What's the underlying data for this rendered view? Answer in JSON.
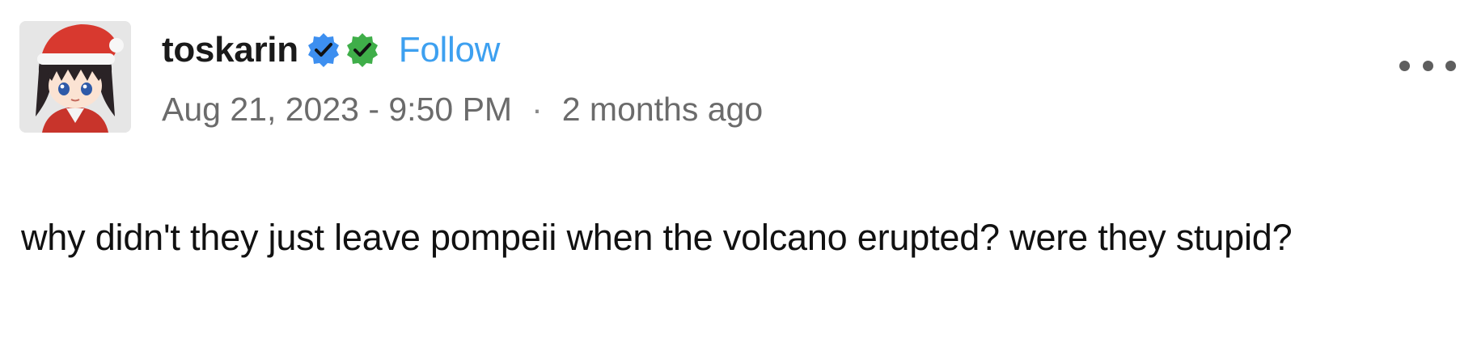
{
  "post": {
    "author": {
      "username": "toskarin",
      "follow_label": "Follow"
    },
    "badges": [
      {
        "icon": "verified-check-icon",
        "color": "#3d8ff0"
      },
      {
        "icon": "verified-check-icon",
        "color": "#3fae49"
      }
    ],
    "meta": {
      "timestamp": "Aug 21, 2023 - 9:50 PM",
      "separator": "·",
      "relative_time": "2 months ago"
    },
    "more_icon": "more-options-icon",
    "text": "why didn't they just leave pompeii when the volcano erupted? were they stupid?"
  },
  "colors": {
    "follow": "#3da0f0",
    "meta": "#6b6b6b",
    "text": "#111111"
  }
}
